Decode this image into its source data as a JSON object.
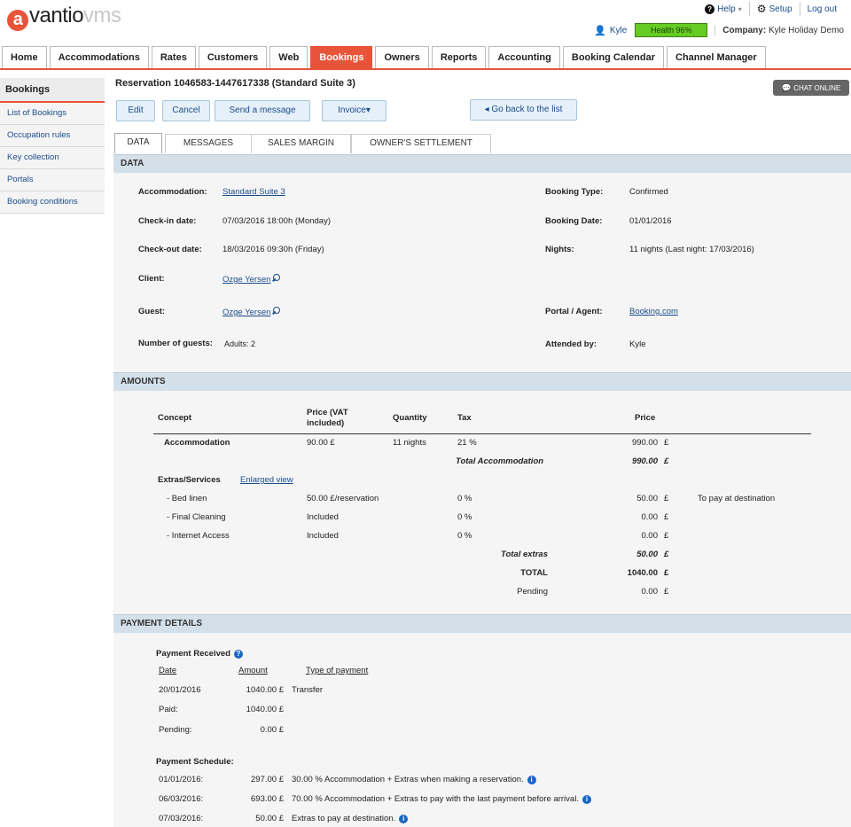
{
  "brand": {
    "logo_a": "a",
    "logo_main": "vantio",
    "logo_suffix": "vms"
  },
  "toplinks": {
    "help": "Help",
    "help_caret": "▾",
    "setup": "Setup",
    "logout": "Log out"
  },
  "user": {
    "name": "Kyle",
    "health": "Health 96%",
    "company_label": "Company:",
    "company_name": "Kyle Holiday Demo"
  },
  "nav": {
    "tabs": [
      "Home",
      "Accommodations",
      "Rates",
      "Customers",
      "Web",
      "Bookings",
      "Owners",
      "Reports",
      "Accounting",
      "Booking Calendar",
      "Channel Manager"
    ],
    "active": "Bookings"
  },
  "sidebar": {
    "header": "Bookings",
    "items": [
      "List of Bookings",
      "Occupation rules",
      "Key collection",
      "Portals",
      "Booking conditions"
    ]
  },
  "reservation": {
    "title": "Reservation 1046583-1447617338 (Standard Suite 3)",
    "chat": "CHAT ONLINE"
  },
  "actions": {
    "edit": "Edit",
    "cancel": "Cancel",
    "send_message": "Send a message",
    "invoice": "Invoice",
    "invoice_caret": "▾",
    "go_back": "Go back to the list",
    "go_back_arrow": "◂"
  },
  "tabs": [
    "DATA",
    "MESSAGES",
    "SALES MARGIN",
    "OWNER'S SETTLEMENT"
  ],
  "data_section": {
    "header": "DATA",
    "accommodation_label": "Accommodation:",
    "accommodation": "Standard Suite 3",
    "checkin_label": "Check-in date:",
    "checkin": "07/03/2016 18:00h (Monday)",
    "checkout_label": "Check-out date:",
    "checkout": "18/03/2016 09:30h (Friday)",
    "client_label": "Client:",
    "client": "Ozge Yersen",
    "guest_label": "Guest:",
    "guest": "Ozge Yersen",
    "guests_label": "Number of guests:",
    "guests": "Adults: 2",
    "booking_type_label": "Booking Type:",
    "booking_type": "Confirmed",
    "booking_date_label": "Booking Date:",
    "booking_date": "01/01/2016",
    "nights_label": "Nights:",
    "nights": "11 nights (Last night: 17/03/2016)",
    "portal_label": "Portal / Agent:",
    "portal": "Booking.com",
    "attended_label": "Attended by:",
    "attended": "Kyle"
  },
  "amounts": {
    "header": "AMOUNTS",
    "columns": {
      "concept": "Concept",
      "price_vat": "Price (VAT included)",
      "quantity": "Quantity",
      "tax": "Tax",
      "price": "Price"
    },
    "accommodation": {
      "concept": "Accommodation",
      "price": "90.00 £",
      "quantity": "11 nights",
      "tax": "21 %",
      "total": "990.00",
      "currency": "£"
    },
    "total_accommodation": {
      "label": "Total Accommodation",
      "value": "990.00",
      "currency": "£"
    },
    "extras_label": "Extras/Services",
    "enlarged_view": "Enlarged view",
    "extras": [
      {
        "name": "- Bed linen",
        "price": "50.00 £/reservation",
        "tax": "0 %",
        "total": "50.00",
        "currency": "£",
        "note": "To pay at destination"
      },
      {
        "name": "- Final Cleaning",
        "price": "Included",
        "tax": "0 %",
        "total": "0.00",
        "currency": "£",
        "note": ""
      },
      {
        "name": "- Internet Access",
        "price": "Included",
        "tax": "0 %",
        "total": "0.00",
        "currency": "£",
        "note": ""
      }
    ],
    "total_extras": {
      "label": "Total extras",
      "value": "50.00",
      "currency": "£"
    },
    "total": {
      "label": "TOTAL",
      "value": "1040.00",
      "currency": "£"
    },
    "pending": {
      "label": "Pending",
      "value": "0.00",
      "currency": "£"
    }
  },
  "payment": {
    "header": "PAYMENT DETAILS",
    "received_label": "Payment Received",
    "columns": {
      "date": "Date",
      "amount": "Amount",
      "type": "Type of payment"
    },
    "rows": [
      {
        "date": "20/01/2016",
        "amount": "1040.00 £",
        "type": "Transfer"
      }
    ],
    "paid_label": "Paid:",
    "paid": "1040.00 £",
    "pending_label": "Pending:",
    "pending": "0.00 £",
    "schedule_label": "Payment Schedule:",
    "schedule": [
      {
        "date": "01/01/2016:",
        "amount": "297.00 £",
        "desc": "30.00 % Accommodation + Extras when making a reservation."
      },
      {
        "date": "06/03/2016:",
        "amount": "693.00 £",
        "desc": "70.00 % Accommodation + Extras to pay with the last payment before arrival."
      },
      {
        "date": "07/03/2016:",
        "amount": "50.00 £",
        "desc": "Extras to pay at destination."
      }
    ]
  },
  "colors": {
    "accent": "#e8543a",
    "section_header": "#d3e0ea",
    "link": "#1a4c8a",
    "health": "#66cc22",
    "info": "#1a66c0"
  },
  "icons": {
    "help": "question-circle-icon",
    "setup": "gear-icon",
    "user": "user-icon",
    "chat": "chat-bubble-icon",
    "search": "magnifier-icon",
    "info": "info-circle-icon",
    "back": "arrow-left-icon"
  }
}
